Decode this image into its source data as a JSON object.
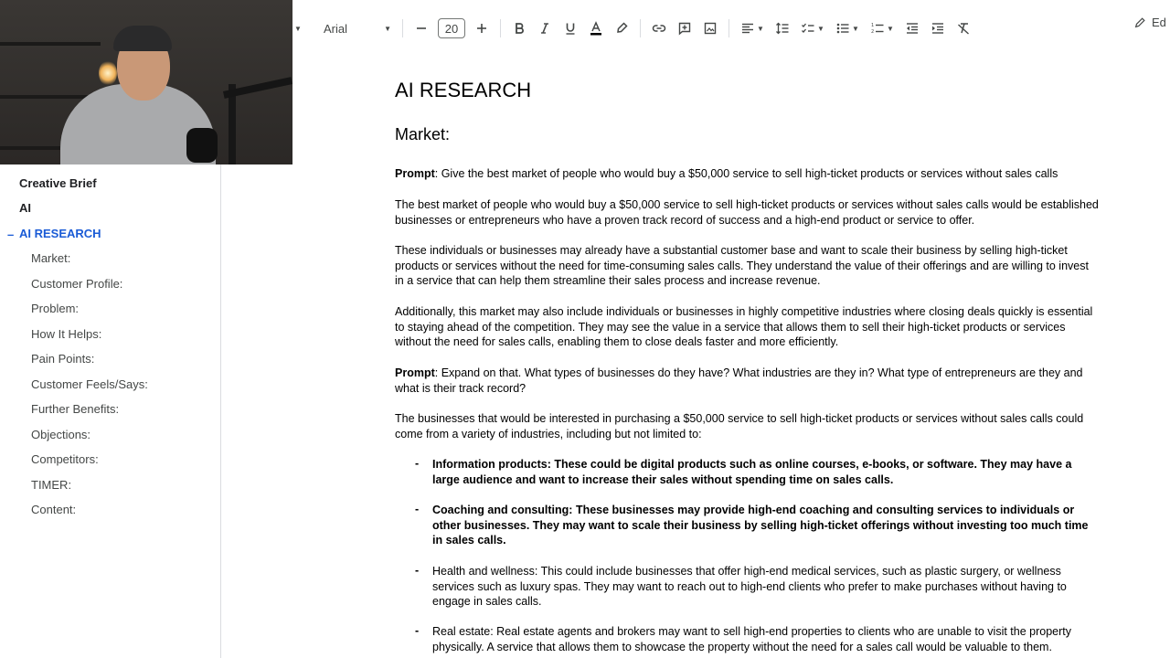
{
  "toolbar": {
    "font_name": "Arial",
    "font_size": "20",
    "edit_label": "Ed"
  },
  "outline": {
    "items": [
      {
        "label": "Creative Brief",
        "level": "h1"
      },
      {
        "label": "AI",
        "level": "h1"
      },
      {
        "label": "AI RESEARCH",
        "level": "active"
      },
      {
        "label": "Market:",
        "level": "h2"
      },
      {
        "label": "Customer Profile:",
        "level": "h2"
      },
      {
        "label": "Problem:",
        "level": "h2"
      },
      {
        "label": "How It Helps:",
        "level": "h2"
      },
      {
        "label": "Pain Points:",
        "level": "h2"
      },
      {
        "label": "Customer Feels/Says:",
        "level": "h2"
      },
      {
        "label": "Further Benefits:",
        "level": "h2"
      },
      {
        "label": "Objections:",
        "level": "h2"
      },
      {
        "label": "Competitors:",
        "level": "h2"
      },
      {
        "label": "TIMER:",
        "level": "h2"
      },
      {
        "label": "Content:",
        "level": "h2"
      }
    ],
    "collapse_mark": "–"
  },
  "document": {
    "title": "AI RESEARCH",
    "heading": "Market:",
    "prompt_label": "Prompt",
    "prompt1": ": Give the best market of people who would buy a $50,000 service to sell high-ticket products or services without sales calls",
    "para1": "The best market of people who would buy a $50,000 service to sell high-ticket products or services without sales calls would be established businesses or entrepreneurs who have a proven track record of success and a high-end product or service to offer.",
    "para2": "These individuals or businesses may already have a substantial customer base and want to scale their business by selling high-ticket products or services without the need for time-consuming sales calls. They understand the value of their offerings and are willing to invest in a service that can help them streamline their sales process and increase revenue.",
    "para3": "Additionally, this market may also include individuals or businesses in highly competitive industries where closing deals quickly is essential to staying ahead of the competition. They may see the value in a service that allows them to sell their high-ticket products or services without the need for sales calls, enabling them to close deals faster and more efficiently.",
    "prompt2": ": Expand on that.  What types of businesses do they have?  What industries are they in?  What type of entrepreneurs are they and what is their track record?",
    "para4": "The businesses that would be interested in purchasing a $50,000 service to sell high-ticket products or services without sales calls could come from a variety of industries, including but not limited to:",
    "bullet_mark": "-",
    "bullets": [
      "Information products: These could be digital products such as online courses, e-books, or software. They may have a large audience and want to increase their sales without spending time on sales calls.",
      "Coaching and consulting: These businesses may provide high-end coaching and consulting services to individuals or other businesses. They may want to scale their business by selling high-ticket offerings without investing too much time in sales calls.",
      "Health and wellness: This could include businesses that offer high-end medical services, such as plastic surgery, or wellness services such as luxury spas. They may want to reach out to high-end clients who prefer to make purchases without having to engage in sales calls.",
      "Real estate: Real estate agents and brokers may want to sell high-end properties to clients who are unable to visit the property physically. A service that allows them to showcase the property without the need for a sales call would be valuable to them."
    ]
  }
}
